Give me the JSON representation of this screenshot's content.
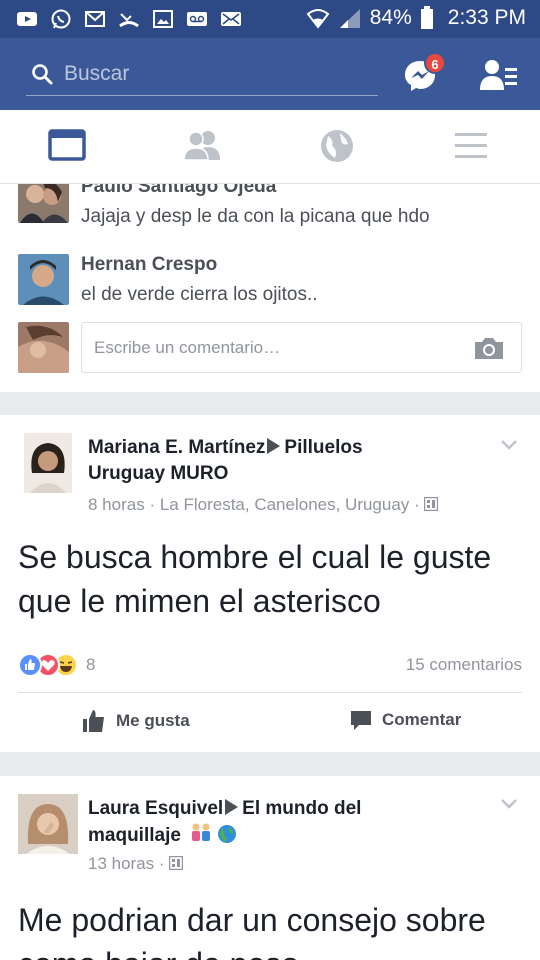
{
  "status_bar": {
    "left_icons": [
      "youtube-icon",
      "whatsapp-icon",
      "gmail-icon",
      "missed-call-icon",
      "gallery-icon",
      "voicemail-icon",
      "email-icon"
    ],
    "battery": "84%",
    "time": "2:33 PM"
  },
  "search": {
    "placeholder": "Buscar"
  },
  "messenger": {
    "badge": "6"
  },
  "tabs": [
    "news-feed-icon",
    "friends-icon",
    "globe-icon",
    "menu-icon"
  ],
  "comments": [
    {
      "name": "Paulo Santiago Ojeda",
      "text": "Jajaja y desp le da con la picana que hdo"
    },
    {
      "name": "Hernan Crespo",
      "text": "el de verde cierra los ojitos.."
    }
  ],
  "write_comment": {
    "placeholder": "Escribe un comentario…"
  },
  "posts": [
    {
      "author": "Mariana E. Martínez",
      "target": "Pilluelos Uruguay MURO",
      "time": "8 horas",
      "location": "La Floresta, Canelones, Uruguay",
      "text": "Se busca hombre el cual le guste que le mimen el asterisco",
      "reactions_count": "8",
      "comments_count": "15 comentarios",
      "like_label": "Me gusta",
      "comment_label": "Comentar"
    },
    {
      "author": "Laura Esquivel",
      "target": "El mundo del maquillaje",
      "time": "13 horas",
      "text": "Me podrian dar un consejo sobre como bajar de peso"
    }
  ],
  "colors": {
    "header": "#3b5998",
    "status_bar": "#2e4a86",
    "badge": "#e9473f",
    "like_blue": "#5890ff",
    "love_red": "#f25268",
    "haha_yellow": "#fcd34a"
  }
}
